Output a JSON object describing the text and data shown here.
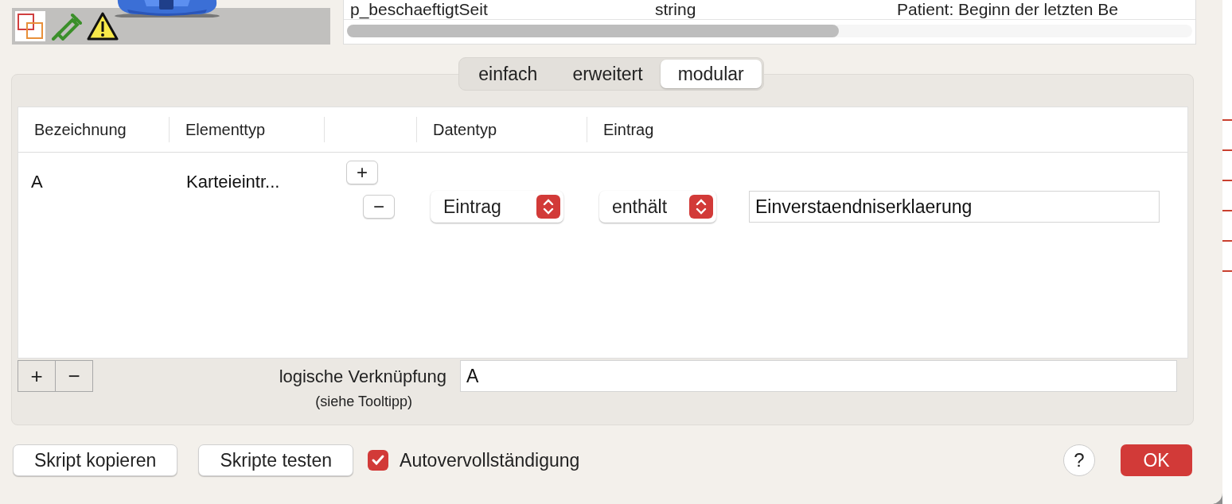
{
  "toolbar": {
    "icons": [
      {
        "kind": "overlap"
      },
      {
        "kind": "syringe"
      },
      {
        "kind": "warning"
      }
    ]
  },
  "variables_table": {
    "rows": [
      {
        "name": "p_beschaeftigtSeit",
        "type": "string",
        "description": "Patient: Beginn der letzten Be"
      }
    ]
  },
  "tabs": [
    {
      "label": "einfach",
      "selected": false
    },
    {
      "label": "erweitert",
      "selected": false
    },
    {
      "label": "modular",
      "selected": true
    }
  ],
  "conditions_table": {
    "columns": [
      "Bezeichnung",
      "Elementtyp",
      "Datentyp",
      "Eintrag"
    ],
    "rows": [
      {
        "name": "A",
        "element_type": "Karteieintr...",
        "add": "+",
        "remove": "−",
        "data_type": "Eintrag",
        "operator": "enthält",
        "value": "Einverstaendniserklaerung"
      }
    ]
  },
  "row_buttons": [
    "+",
    "−"
  ],
  "logic": {
    "label": "logische Verknüpfung",
    "hint": "(siehe Tooltipp)",
    "value": "A"
  },
  "footer": {
    "buttons": [
      "Skript kopieren",
      "Skripte testen"
    ],
    "autocomplete": {
      "label": "Autovervollständigung",
      "checked": true
    },
    "help": "?",
    "ok": "OK"
  }
}
